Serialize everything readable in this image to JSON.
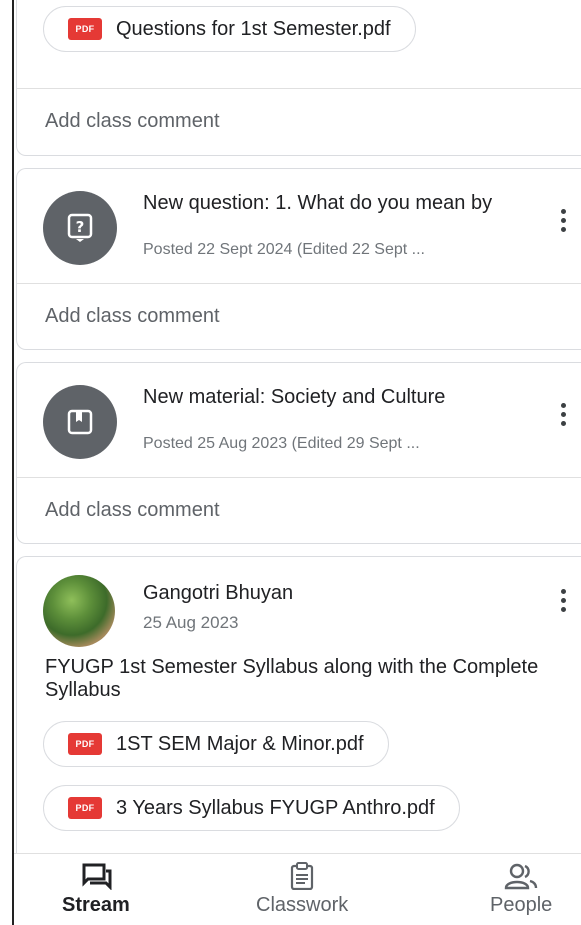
{
  "top_card": {
    "attachment": "Questions for 1st Semester.pdf",
    "comment_placeholder": "Add class comment"
  },
  "posts": [
    {
      "icon": "question-icon",
      "title": "New question: 1. What do you mean by",
      "subtitle": "Posted 22 Sept 2024 (Edited 22 Sept ...",
      "comment_placeholder": "Add class comment"
    },
    {
      "icon": "material-icon",
      "title": "New material: Society and Culture",
      "subtitle": "Posted 25 Aug 2023 (Edited 29 Sept ...",
      "comment_placeholder": "Add class comment"
    }
  ],
  "announcement": {
    "author": "Gangotri Bhuyan",
    "date": "25 Aug 2023",
    "text": "FYUGP 1st Semester Syllabus along with the Complete Syllabus",
    "attachments": [
      "1ST SEM Major & Minor.pdf",
      "3 Years Syllabus FYUGP Anthro.pdf"
    ]
  },
  "pdf_badge": "PDF",
  "nav": {
    "stream": "Stream",
    "classwork": "Classwork",
    "people": "People"
  },
  "colors": {
    "pdf_red": "#e53935",
    "icon_bg": "#5f6368",
    "border": "#dadce0"
  }
}
